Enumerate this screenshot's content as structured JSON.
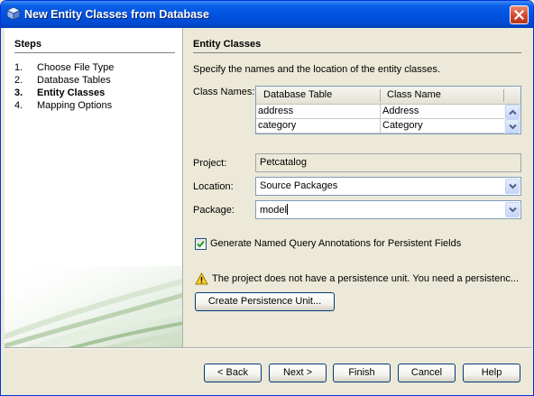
{
  "window": {
    "title": "New Entity Classes from Database"
  },
  "steps": {
    "title": "Steps",
    "items": [
      {
        "num": "1.",
        "label": "Choose File Type"
      },
      {
        "num": "2.",
        "label": "Database Tables"
      },
      {
        "num": "3.",
        "label": "Entity Classes"
      },
      {
        "num": "4.",
        "label": "Mapping Options"
      }
    ],
    "current_index": 2
  },
  "main": {
    "section_title": "Entity Classes",
    "instructions": "Specify the names and the location of the entity classes.",
    "class_names_label": "Class Names:",
    "table": {
      "columns": [
        "Database Table",
        "Class Name"
      ],
      "rows": [
        [
          "address",
          "Address"
        ],
        [
          "category",
          "Category"
        ]
      ]
    },
    "project": {
      "label": "Project:",
      "value": "Petcatalog"
    },
    "location": {
      "label": "Location:",
      "value": "Source Packages"
    },
    "package": {
      "label": "Package:",
      "value": "model"
    },
    "named_query_checkbox": {
      "label": "Generate Named Query Annotations for Persistent Fields",
      "checked": true
    },
    "warning": "The project does not have a persistence unit. You need a persistenc...",
    "create_pu_button": "Create Persistence Unit..."
  },
  "buttons": {
    "back": "< Back",
    "next": "Next >",
    "finish": "Finish",
    "cancel": "Cancel",
    "help": "Help"
  },
  "colors": {
    "titlebar": "#0054e3",
    "dialog_bg": "#ece9d8",
    "field_border": "#7f9db9"
  }
}
